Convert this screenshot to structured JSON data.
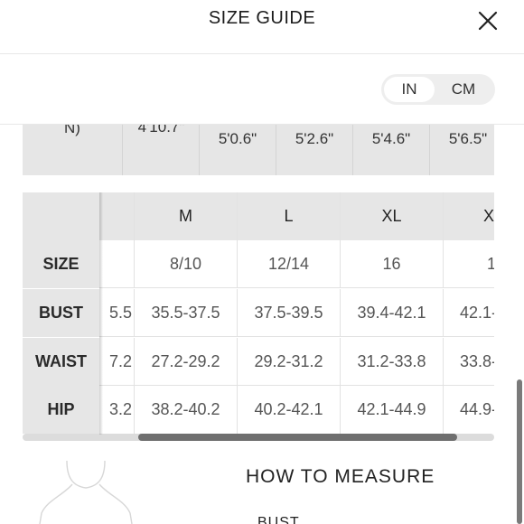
{
  "header": {
    "title": "SIZE GUIDE",
    "close_icon": "close-icon"
  },
  "units": {
    "options": [
      "IN",
      "CM"
    ],
    "selected": "IN"
  },
  "height_table": {
    "label": "N)",
    "values": [
      "4'10.7\"",
      "5'0.6\"",
      "5'2.6\"",
      "5'4.6\"",
      "5'6.5\""
    ]
  },
  "size_table": {
    "columns": [
      "",
      "M",
      "L",
      "XL",
      "XX"
    ],
    "rows": [
      {
        "label": "SIZE",
        "values": [
          "",
          "8/10",
          "12/14",
          "16",
          "1"
        ]
      },
      {
        "label": "BUST",
        "values": [
          "5.5",
          "35.5-37.5",
          "37.5-39.5",
          "39.4-42.1",
          "42.1-"
        ]
      },
      {
        "label": "WAIST",
        "values": [
          "7.2",
          "27.2-29.2",
          "29.2-31.2",
          "31.2-33.8",
          "33.8-"
        ]
      },
      {
        "label": "HIP",
        "values": [
          "3.2",
          "38.2-40.2",
          "40.2-42.1",
          "42.1-44.9",
          "44.9-"
        ]
      }
    ]
  },
  "measure": {
    "heading": "HOW TO MEASURE",
    "first_item": "BUST"
  }
}
